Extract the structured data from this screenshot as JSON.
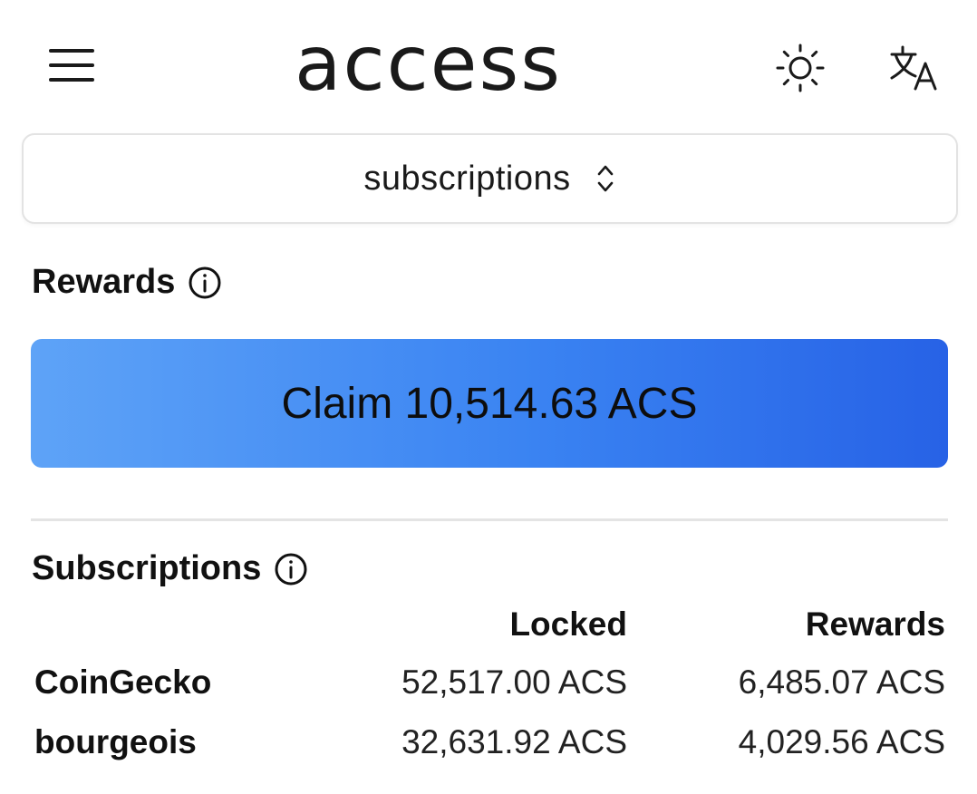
{
  "header": {
    "logo_text": "access",
    "menu_icon": "hamburger-menu-icon",
    "theme_icon": "sun-icon",
    "language_icon": "translate-icon"
  },
  "view_select": {
    "selected": "subscriptions",
    "icon": "chevron-up-down-icon"
  },
  "rewards": {
    "title": "Rewards",
    "claim_button": "Claim 10,514.63 ACS"
  },
  "subscriptions": {
    "title": "Subscriptions",
    "columns": [
      "Locked",
      "Rewards"
    ],
    "rows": [
      {
        "name": "CoinGecko",
        "locked": "52,517.00 ACS",
        "rewards": "6,485.07 ACS"
      },
      {
        "name": "bourgeois",
        "locked": "32,631.92 ACS",
        "rewards": "4,029.56 ACS"
      }
    ]
  },
  "colors": {
    "claim_gradient_start": "#5ea3f7",
    "claim_gradient_end": "#2762e6",
    "text": "#111111",
    "divider": "#e4e4e4"
  }
}
